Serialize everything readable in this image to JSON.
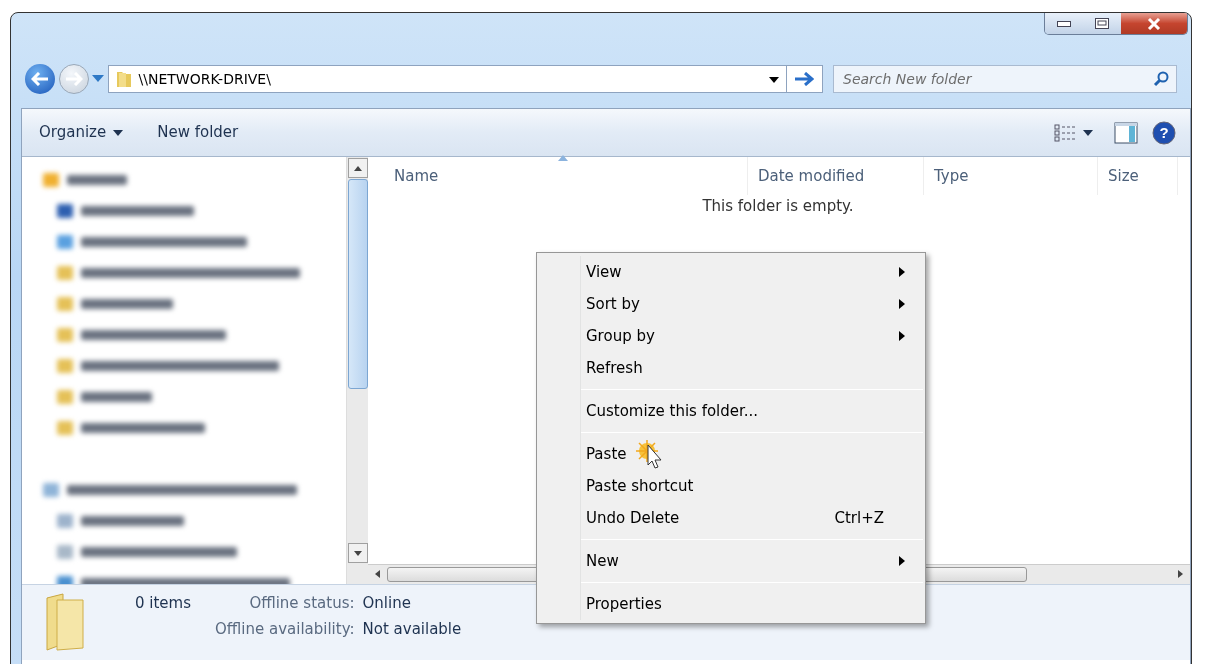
{
  "address_bar": {
    "path": "\\\\NETWORK-DRIVE\\"
  },
  "search": {
    "placeholder": "Search New folder"
  },
  "toolbar": {
    "buttons": [
      {
        "label": "Organize",
        "dropdown": true
      },
      {
        "label": "New folder",
        "dropdown": false
      }
    ],
    "help_glyph": "?"
  },
  "sidebar": {
    "items": [
      {
        "kind": "star"
      },
      {
        "kind": "desktop"
      },
      {
        "kind": "dropbox"
      },
      {
        "kind": "folder"
      },
      {
        "kind": "folder"
      },
      {
        "kind": "folder"
      },
      {
        "kind": "folder"
      },
      {
        "kind": "folder"
      },
      {
        "kind": "folder"
      },
      {
        "kind": "gap"
      },
      {
        "kind": "library"
      },
      {
        "kind": "doc"
      },
      {
        "kind": "git"
      },
      {
        "kind": "music"
      }
    ]
  },
  "table": {
    "columns": [
      {
        "label": "Name",
        "sorted": true
      },
      {
        "label": "Date modified",
        "sorted": false
      },
      {
        "label": "Type",
        "sorted": false
      },
      {
        "label": "Size",
        "sorted": false
      }
    ],
    "empty_message": "This folder is empty."
  },
  "context_menu": {
    "groups": [
      [
        {
          "label": "View",
          "submenu": true
        },
        {
          "label": "Sort by",
          "submenu": true
        },
        {
          "label": "Group by",
          "submenu": true
        },
        {
          "label": "Refresh",
          "submenu": false
        }
      ],
      [
        {
          "label": "Customize this folder...",
          "submenu": false
        }
      ],
      [
        {
          "label": "Paste",
          "submenu": false
        },
        {
          "label": "Paste shortcut",
          "submenu": false
        },
        {
          "label": "Undo Delete",
          "submenu": false,
          "shortcut": "Ctrl+Z"
        }
      ],
      [
        {
          "label": "New",
          "submenu": true
        }
      ],
      [
        {
          "label": "Properties",
          "submenu": false
        }
      ]
    ]
  },
  "status_bar": {
    "count": "0 items",
    "details": [
      {
        "label": "Offline status:",
        "value": "Online"
      },
      {
        "label": "Offline availability:",
        "value": "Not available"
      }
    ]
  }
}
